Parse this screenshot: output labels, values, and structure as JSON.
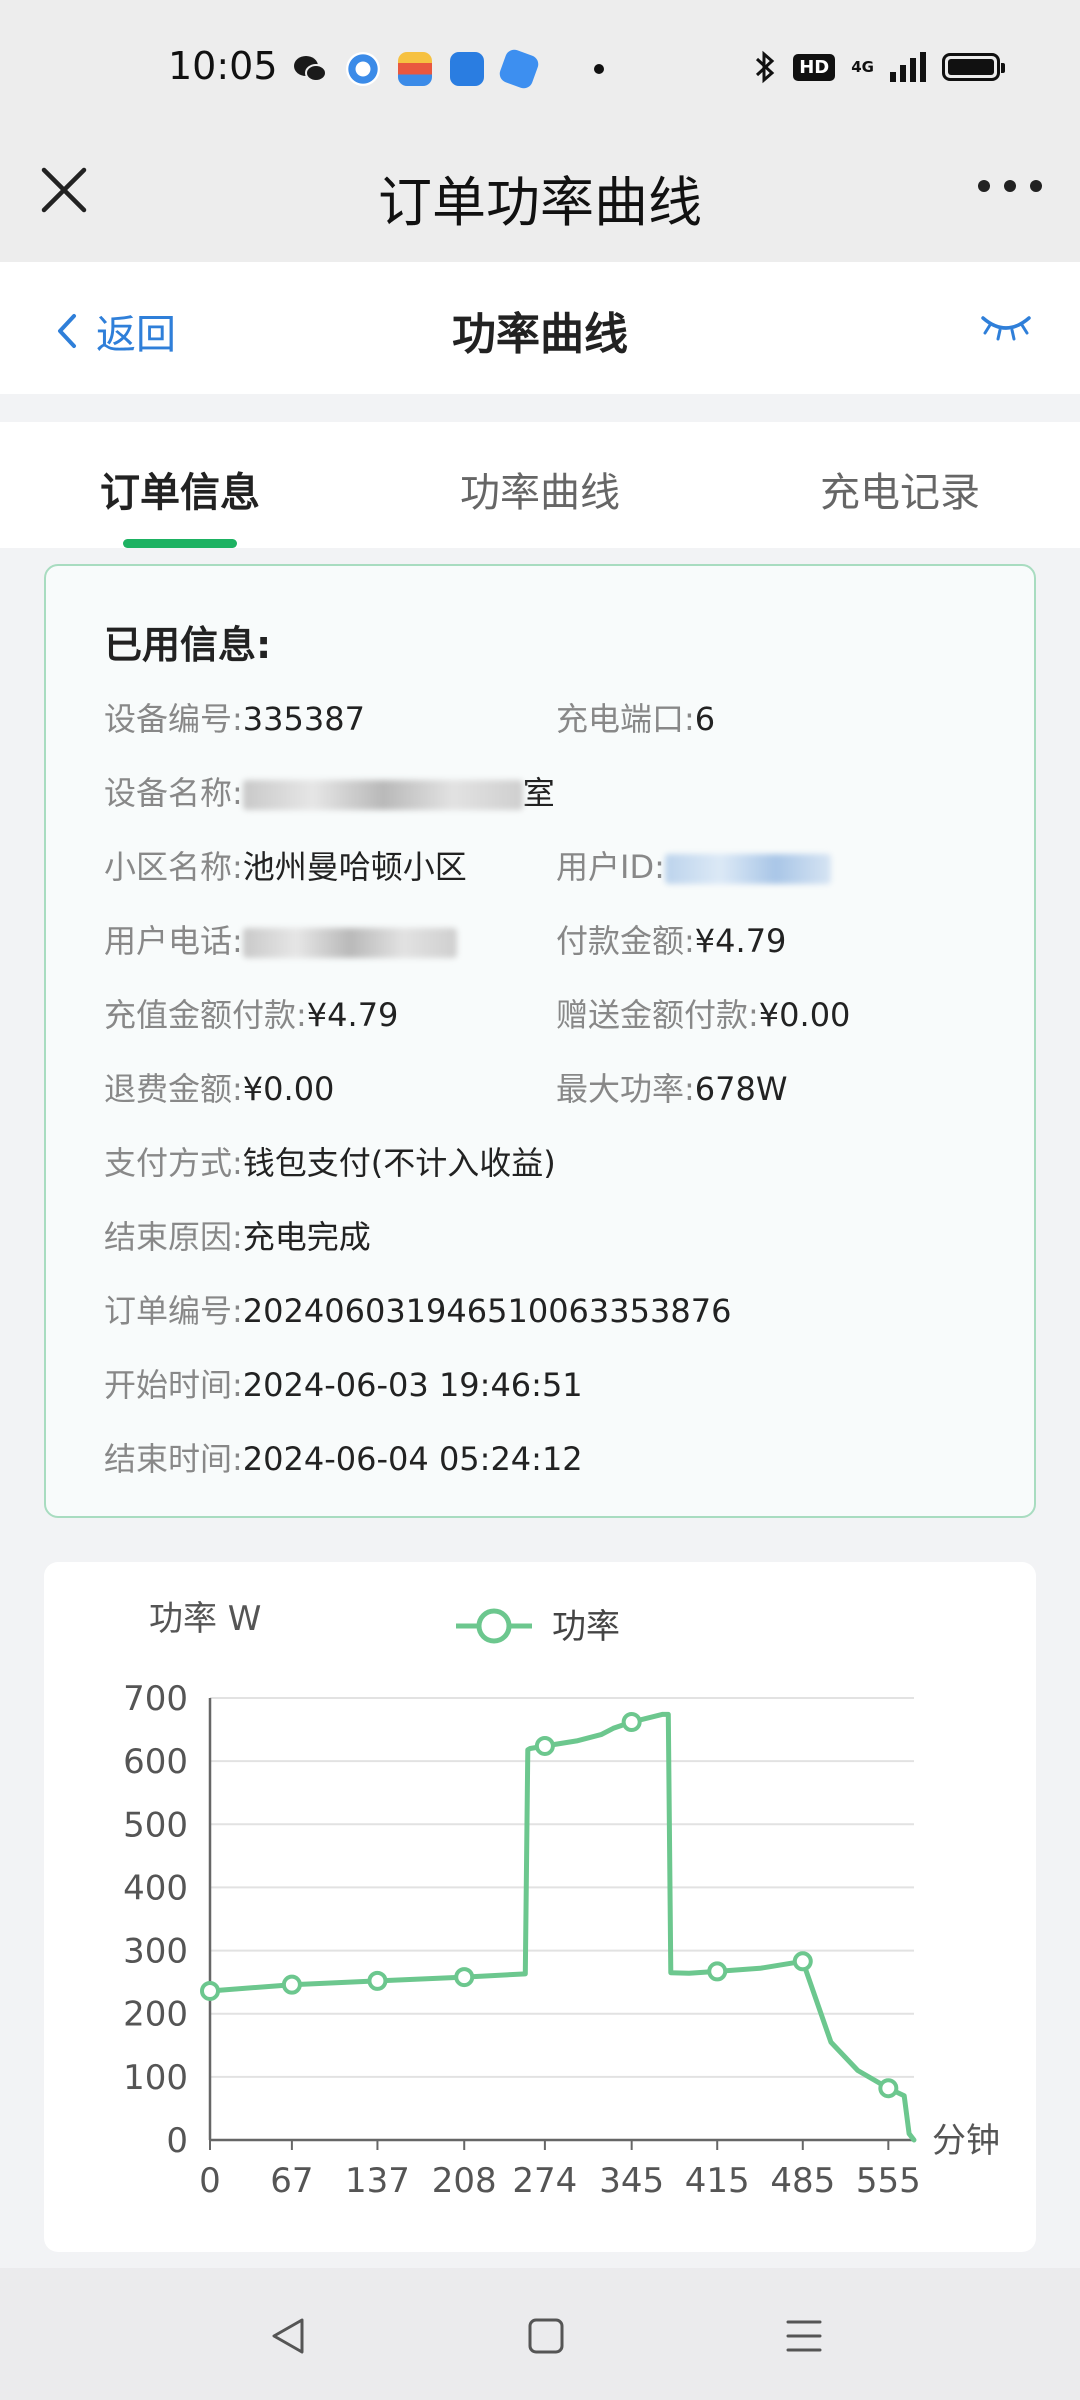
{
  "status_bar": {
    "time": "10:05",
    "apps": [
      {
        "icon": "wechat-icon",
        "color": "#1a1a1a"
      },
      {
        "icon": "browser-icon",
        "color": "#3b8be8"
      },
      {
        "icon": "wallet-icon",
        "color": "#f2a93b"
      },
      {
        "icon": "yupao-app-icon",
        "color": "#2a7de1"
      },
      {
        "icon": "app-icon",
        "color": "#3d8ff0"
      }
    ],
    "hd": "HD",
    "network": "4G",
    "icons": [
      "bluetooth-icon",
      "signal-icon",
      "battery-icon"
    ]
  },
  "title_bar": {
    "title": "订单功率曲线"
  },
  "nav_bar": {
    "back_label": "返回",
    "title": "功率曲线"
  },
  "tabs": [
    {
      "label": "订单信息",
      "active": true
    },
    {
      "label": "功率曲线",
      "active": false
    },
    {
      "label": "充电记录",
      "active": false
    }
  ],
  "info": {
    "title": "已用信息:",
    "device_no_label": "设备编号:",
    "device_no": "335387",
    "port_label": "充电端口:",
    "port": "6",
    "device_name_label": "设备名称:",
    "device_name_tail": "室",
    "community_label": "小区名称:",
    "community": "池州曼哈顿小区",
    "user_id_label": "用户ID:",
    "phone_label": "用户电话:",
    "pay_amount_label": "付款金额:",
    "pay_amount": "¥4.79",
    "recharge_pay_label": "充值金额付款:",
    "recharge_pay": "¥4.79",
    "gift_pay_label": "赠送金额付款:",
    "gift_pay": "¥0.00",
    "refund_label": "退费金额:",
    "refund": "¥0.00",
    "max_power_label": "最大功率:",
    "max_power": "678W",
    "pay_method_label": "支付方式:",
    "pay_method": "钱包支付(不计入收益)",
    "end_reason_label": "结束原因:",
    "end_reason": "充电完成",
    "order_no_label": "订单编号:",
    "order_no": "20240603194651006335387­6",
    "start_time_label": "开始时间:",
    "start_time": "2024-06-03 19:46:51",
    "end_time_label": "结束时间:",
    "end_time": "2024-06-04 05:24:12"
  },
  "chart_data": {
    "type": "line",
    "ylabel": "功率 W",
    "xlabel": "分钟",
    "legend": [
      "功率"
    ],
    "legend_position": "top-center",
    "ylim": [
      0,
      700
    ],
    "xlim": [
      0,
      576
    ],
    "yticks": [
      0,
      100,
      200,
      300,
      400,
      500,
      600,
      700
    ],
    "xticks": [
      0,
      67,
      137,
      208,
      274,
      345,
      415,
      485,
      555
    ],
    "grid": true,
    "color": "#6cc78e",
    "series": [
      {
        "name": "功率",
        "x": [
          0,
          67,
          137,
          208,
          258,
          260,
          262,
          274,
          300,
          320,
          330,
          345,
          370,
          375,
          377,
          392,
          415,
          450,
          485,
          508,
          530,
          555,
          568,
          572,
          576
        ],
        "y": [
          236,
          246,
          252,
          258,
          263,
          618,
          620,
          624,
          632,
          642,
          652,
          662,
          674,
          674,
          265,
          264,
          267,
          272,
          283,
          155,
          110,
          82,
          70,
          10,
          0
        ],
        "markers_at_x": [
          0,
          67,
          137,
          208,
          274,
          345,
          415,
          485,
          555
        ]
      }
    ]
  },
  "system_nav": {
    "icons": [
      "back-triangle-icon",
      "home-square-icon",
      "menu-lines-icon"
    ]
  }
}
